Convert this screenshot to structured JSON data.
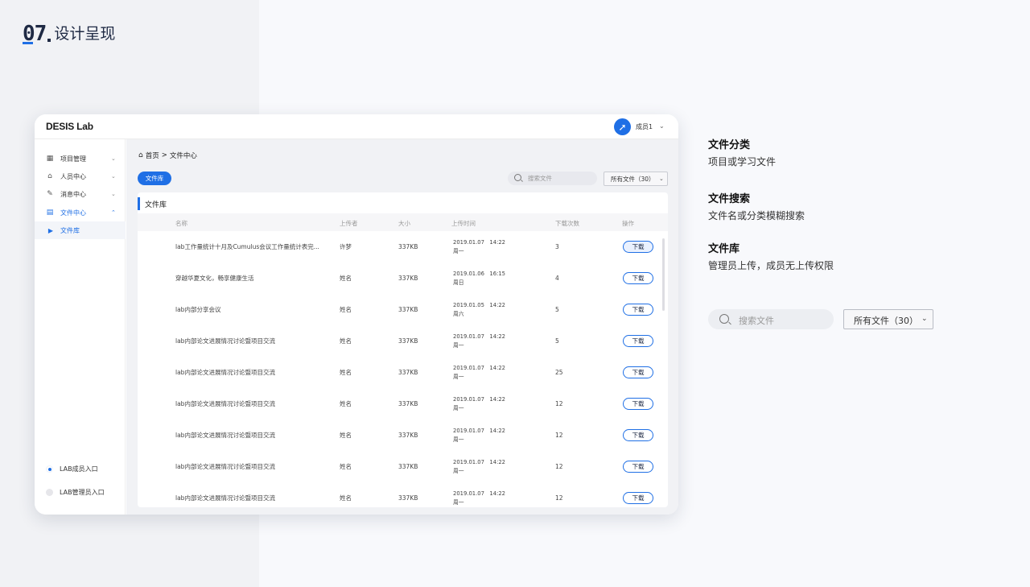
{
  "slide": {
    "number": "07",
    "title": "设计呈现"
  },
  "app": {
    "brand": "DESIS Lab",
    "user": {
      "avatar_glyph": "➚",
      "name": "成员1",
      "chevron": "⌄"
    }
  },
  "sidebar": {
    "items": [
      {
        "label": "项目管理",
        "icon": "grid-icon",
        "glyph": "▦",
        "chevron": "⌄"
      },
      {
        "label": "人员中心",
        "icon": "people-icon",
        "glyph": "⌂",
        "chevron": "⌄"
      },
      {
        "label": "消息中心",
        "icon": "send-icon",
        "glyph": "✎",
        "chevron": "⌄"
      },
      {
        "label": "文件中心",
        "icon": "file-icon",
        "glyph": "▤",
        "chevron": "⌃"
      }
    ],
    "sub_item": {
      "label": "文件库",
      "glyph": "▶"
    },
    "entries": [
      "LAB成员入口",
      "LAB管理员入口"
    ]
  },
  "breadcrumb": {
    "home_glyph": "⌂",
    "home": "首页",
    "sep": ">",
    "current": "文件中心"
  },
  "toolbar": {
    "tab_button": "文件库",
    "search_placeholder": "搜索文件",
    "select_value": "所有文件（30）",
    "select_chevron": "⌄"
  },
  "card": {
    "title": "文件库"
  },
  "table": {
    "headers": [
      "名称",
      "上传者",
      "大小",
      "上传时间",
      "下载次数",
      "操作"
    ],
    "rows": [
      {
        "name": "lab工作量统计十月及Cumulus会议工作量统计表完...",
        "uploader": "许梦",
        "size": "337KB",
        "date": "2019.01.07   14:22",
        "day": "周一",
        "downloads": "3",
        "action": "下载"
      },
      {
        "name": "穿越华夏文化，畅享健康生活",
        "uploader": "姓名",
        "size": "337KB",
        "date": "2019.01.06   16:15",
        "day": "周日",
        "downloads": "4",
        "action": "下载"
      },
      {
        "name": "lab内部分享会议",
        "uploader": "姓名",
        "size": "337KB",
        "date": "2019.01.05   14:22",
        "day": "周六",
        "downloads": "5",
        "action": "下载"
      },
      {
        "name": "lab内部论文进展情况讨论暨项目交流",
        "uploader": "姓名",
        "size": "337KB",
        "date": "2019.01.07   14:22",
        "day": "周一",
        "downloads": "5",
        "action": "下载"
      },
      {
        "name": "lab内部论文进展情况讨论暨项目交流",
        "uploader": "姓名",
        "size": "337KB",
        "date": "2019.01.07   14:22",
        "day": "周一",
        "downloads": "25",
        "action": "下载"
      },
      {
        "name": "lab内部论文进展情况讨论暨项目交流",
        "uploader": "姓名",
        "size": "337KB",
        "date": "2019.01.07   14:22",
        "day": "周一",
        "downloads": "12",
        "action": "下载"
      },
      {
        "name": "lab内部论文进展情况讨论暨项目交流",
        "uploader": "姓名",
        "size": "337KB",
        "date": "2019.01.07   14:22",
        "day": "周一",
        "downloads": "12",
        "action": "下载"
      },
      {
        "name": "lab内部论文进展情况讨论暨项目交流",
        "uploader": "姓名",
        "size": "337KB",
        "date": "2019.01.07   14:22",
        "day": "周一",
        "downloads": "12",
        "action": "下载"
      },
      {
        "name": "lab内部论文进展情况讨论暨项目交流",
        "uploader": "姓名",
        "size": "337KB",
        "date": "2019.01.07   14:22",
        "day": "周一",
        "downloads": "12",
        "action": "下载"
      }
    ]
  },
  "annotations": [
    {
      "title": "文件分类",
      "desc": "项目或学习文件"
    },
    {
      "title": "文件搜索",
      "desc": "文件名或分类模糊搜索"
    },
    {
      "title": "文件库",
      "desc": "管理员上传，成员无上传权限"
    }
  ],
  "demo": {
    "search_placeholder": "搜索文件",
    "select_value": "所有文件（30）",
    "select_chevron": "⌄"
  },
  "colors": {
    "accent": "#1f6fe5",
    "title": "#1f2a44",
    "left_band": "#f1f2f5",
    "page_bg": "#f8f9fc"
  }
}
